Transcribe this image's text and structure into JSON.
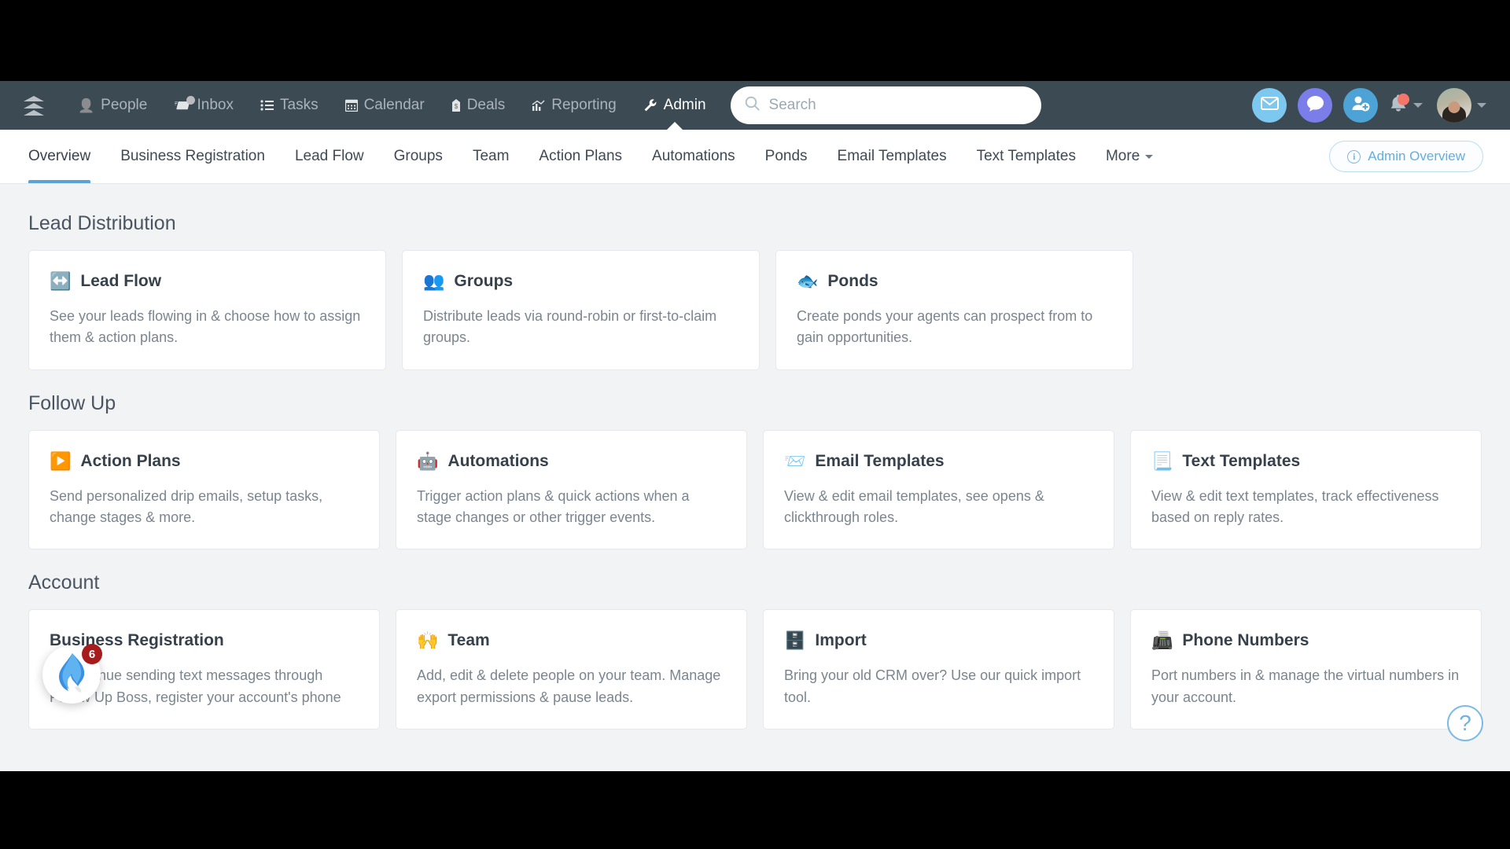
{
  "topnav": {
    "logo_name": "follow-up-boss-logo",
    "items": [
      {
        "label": "People",
        "icon": "👤",
        "icon_name": "person-icon",
        "badge": false,
        "active": false
      },
      {
        "label": "Inbox",
        "icon": "📨",
        "icon_name": "inbox-icon",
        "badge": true,
        "active": false
      },
      {
        "label": "Tasks",
        "icon": "☰",
        "icon_name": "tasks-list-icon",
        "badge": false,
        "active": false
      },
      {
        "label": "Calendar",
        "icon": "📅",
        "icon_name": "calendar-icon",
        "badge": false,
        "active": false
      },
      {
        "label": "Deals",
        "icon": "💰",
        "icon_name": "deals-icon",
        "badge": false,
        "active": false
      },
      {
        "label": "Reporting",
        "icon": "📈",
        "icon_name": "reporting-icon",
        "badge": false,
        "active": false
      },
      {
        "label": "Admin",
        "icon": "🔧",
        "icon_name": "wrench-icon",
        "badge": false,
        "active": true
      }
    ],
    "search": {
      "placeholder": "Search",
      "value": ""
    },
    "actions": [
      {
        "name": "email-button",
        "icon": "envelope-icon",
        "color": "#7dc8ee"
      },
      {
        "name": "messages-button",
        "icon": "chat-bubble-icon",
        "color": "#7b7ee8"
      },
      {
        "name": "add-person-button",
        "icon": "add-person-icon",
        "color": "#4da3d5"
      }
    ],
    "notifications": {
      "name": "notifications-bell",
      "has_unread": true
    },
    "account": {
      "name": "account-avatar"
    }
  },
  "tabbar": {
    "tabs": [
      {
        "label": "Overview",
        "active": true,
        "has_chevron": false
      },
      {
        "label": "Business Registration",
        "active": false,
        "has_chevron": false
      },
      {
        "label": "Lead Flow",
        "active": false,
        "has_chevron": false
      },
      {
        "label": "Groups",
        "active": false,
        "has_chevron": false
      },
      {
        "label": "Team",
        "active": false,
        "has_chevron": false
      },
      {
        "label": "Action Plans",
        "active": false,
        "has_chevron": false
      },
      {
        "label": "Automations",
        "active": false,
        "has_chevron": false
      },
      {
        "label": "Ponds",
        "active": false,
        "has_chevron": false
      },
      {
        "label": "Email Templates",
        "active": false,
        "has_chevron": false
      },
      {
        "label": "Text Templates",
        "active": false,
        "has_chevron": false
      },
      {
        "label": "More",
        "active": false,
        "has_chevron": true
      }
    ],
    "admin_overview_label": "Admin Overview",
    "accent_color": "#58a4d8"
  },
  "sections": [
    {
      "title": "Lead Distribution",
      "cards": [
        {
          "emoji": "↔️",
          "icon_name": "left-right-arrow-icon",
          "title": "Lead Flow",
          "desc": "See your leads flowing in & choose how to assign them & action plans."
        },
        {
          "emoji": "👥",
          "icon_name": "busts-silhouette-icon",
          "title": "Groups",
          "desc": "Distribute leads via round-robin or first-to-claim groups."
        },
        {
          "emoji": "🐟",
          "icon_name": "fish-icon",
          "title": "Ponds",
          "desc": "Create ponds your agents can prospect from to gain opportunities."
        }
      ]
    },
    {
      "title": "Follow Up",
      "cards": [
        {
          "emoji": "▶️",
          "icon_name": "play-button-icon",
          "title": "Action Plans",
          "desc": "Send personalized drip emails, setup tasks, change stages & more."
        },
        {
          "emoji": "🤖",
          "icon_name": "robot-icon",
          "title": "Automations",
          "desc": "Trigger action plans & quick actions when a stage changes or other trigger events."
        },
        {
          "emoji": "📨",
          "icon_name": "incoming-envelope-icon",
          "title": "Email Templates",
          "desc": "View & edit email templates, see opens & clickthrough roles."
        },
        {
          "emoji": "📃",
          "icon_name": "page-with-curl-icon",
          "title": "Text Templates",
          "desc": "View & edit text templates, track effectiveness based on reply rates."
        }
      ]
    },
    {
      "title": "Account",
      "cards": [
        {
          "emoji": "",
          "icon_name": "business-registration-icon",
          "title": "Business Registration",
          "desc": "To continue sending text messages through Follow Up Boss, register your account's phone"
        },
        {
          "emoji": "🙌",
          "icon_name": "raised-hands-icon",
          "title": "Team",
          "desc": "Add, edit & delete people on your team. Manage export permissions & pause leads."
        },
        {
          "emoji": "🗄️",
          "icon_name": "file-cabinet-icon",
          "title": "Import",
          "desc": "Bring your old CRM over? Use our quick import tool."
        },
        {
          "emoji": "📠",
          "icon_name": "fax-machine-icon",
          "title": "Phone Numbers",
          "desc": "Port numbers in & manage the virtual numbers in your account."
        }
      ]
    }
  ],
  "floating": {
    "chat_widget_name": "follow-up-boss-chat-widget",
    "chat_badge_count": "6",
    "help_label": "?"
  }
}
